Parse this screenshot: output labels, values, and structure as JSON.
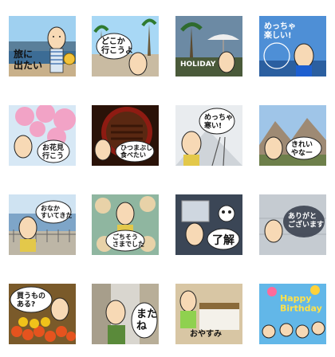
{
  "stickers": [
    {
      "id": "s1",
      "caption": "旅に\n出たい"
    },
    {
      "id": "s2",
      "caption": "どこか\n行こうよ"
    },
    {
      "id": "s3",
      "caption": "HOLIDAY"
    },
    {
      "id": "s4",
      "caption": "めっちゃ\n楽しい!"
    },
    {
      "id": "s5",
      "caption": "お花見\n行こう"
    },
    {
      "id": "s6",
      "caption": "ひつまぶし\n食べたい"
    },
    {
      "id": "s7",
      "caption": "めっちゃ\n寒い!"
    },
    {
      "id": "s8",
      "caption": "きれい\nやなー"
    },
    {
      "id": "s9",
      "caption": "おなか\nすいてきた"
    },
    {
      "id": "s10",
      "caption": "ごちそう\nさまでした"
    },
    {
      "id": "s11",
      "caption": "了解"
    },
    {
      "id": "s12",
      "caption": "ありがと\nございます"
    },
    {
      "id": "s13",
      "caption": "買うもの\nある?"
    },
    {
      "id": "s14",
      "caption": "また\nね"
    },
    {
      "id": "s15",
      "caption": "おやすみ"
    },
    {
      "id": "s16",
      "caption": "Happy\nBirthday"
    }
  ],
  "colors": {
    "skin": "#f7d9b5",
    "outline": "#222222",
    "sky": "#8ec6ec",
    "sea": "#3f7fb5"
  }
}
